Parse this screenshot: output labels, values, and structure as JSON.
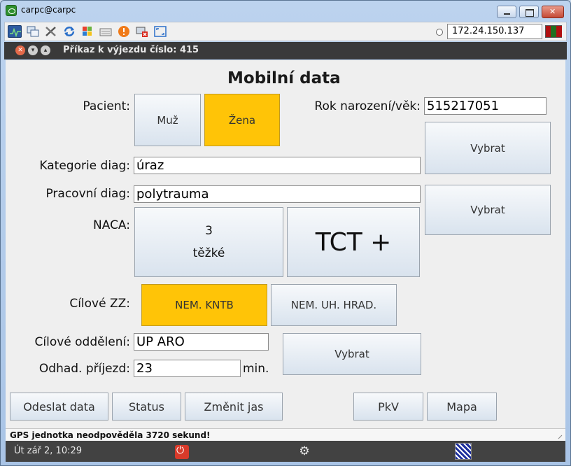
{
  "window": {
    "title": "carpc@carpc"
  },
  "toolbar": {
    "icons": [
      "monitor-icon",
      "windows-icon",
      "tools-icon",
      "refresh-icon",
      "windows-logo-icon",
      "keyboard-icon",
      "warning-icon",
      "disconnect-icon",
      "fullscreen-icon"
    ],
    "ip_address": "172.24.150.137"
  },
  "app_header": {
    "title": "Příkaz k výjezdu číslo: 415"
  },
  "form": {
    "page_title": "Mobilní data",
    "patient_label": "Pacient:",
    "patient_male": "Muž",
    "patient_female": "Žena",
    "birth_label": "Rok narození/věk:",
    "birth_value": "515217051",
    "select_label_1": "Vybrat",
    "category_label": "Kategorie diag:",
    "category_value": "úraz",
    "work_diag_label": "Pracovní diag:",
    "work_diag_value": "polytrauma",
    "select_label_2": "Vybrat",
    "naca_label": "NACA:",
    "naca_number": "3",
    "naca_text": "těžké",
    "tct_label": "TCT +",
    "target_label": "Cílové ZZ:",
    "target_option_1": "NEM. KNTB",
    "target_option_2": "NEM. UH. HRAD.",
    "dept_label": "Cílové oddělení:",
    "dept_value": "UP ARO",
    "select_label_3": "Vybrat",
    "arrival_label": "Odhad. příjezd:",
    "arrival_value": "23",
    "arrival_unit": "min."
  },
  "actions": {
    "send": "Odeslat data",
    "status": "Status",
    "brightness": "Změnit jas",
    "pkv": "PkV",
    "map": "Mapa"
  },
  "status_line": "GPS jednotka neodpověděla 3720 sekund!",
  "system_bar": {
    "clock": "Út zář  2, 10:29"
  },
  "colors": {
    "selected": "#ffc407",
    "header_dark": "#3a3a3a"
  }
}
